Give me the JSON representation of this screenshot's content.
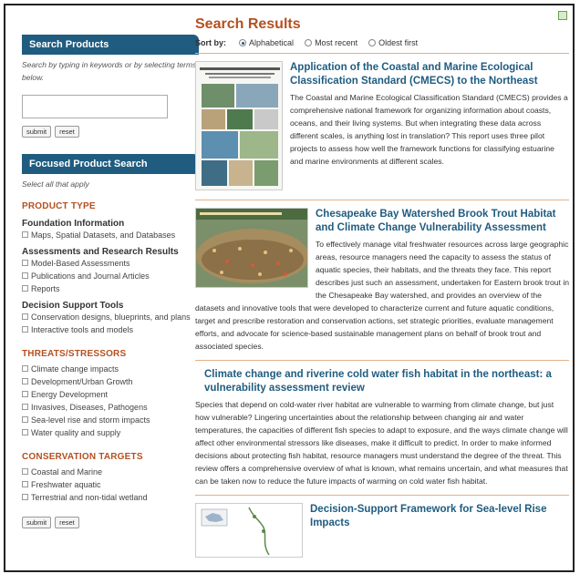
{
  "sidebar": {
    "search_heading": "Search Products",
    "search_help": "Search by typing in keywords or by selecting terms below.",
    "search_placeholder": "",
    "submit_label": "submit",
    "reset_label": "reset",
    "focused_heading": "Focused Product Search",
    "focused_help": "Select all that apply",
    "product_type_title": "PRODUCT TYPE",
    "foundation_title": "Foundation Information",
    "foundation_items": [
      "Maps, Spatial Datasets, and Databases"
    ],
    "assessments_title": "Assessments and Research Results",
    "assessments_items": [
      "Model-Based Assessments",
      "Publications and Journal Articles",
      "Reports"
    ],
    "decision_title": "Decision Support Tools",
    "decision_items": [
      "Conservation designs, blueprints, and plans",
      "Interactive tools and models"
    ],
    "threats_title": "THREATS/STRESSORS",
    "threats_items": [
      "Climate change impacts",
      "Development/Urban Growth",
      "Energy Development",
      "Invasives, Diseases, Pathogens",
      "Sea-level rise and storm impacts",
      "Water quality and supply"
    ],
    "targets_title": "CONSERVATION TARGETS",
    "targets_items": [
      "Coastal and Marine",
      "Freshwater aquatic",
      "Terrestrial and non-tidal wetland"
    ],
    "submit_label_2": "submit",
    "reset_label_2": "reset"
  },
  "main": {
    "title": "Search Results",
    "sort_label": "Sort by:",
    "sort_options": [
      "Alphabetical",
      "Most recent",
      "Oldest first"
    ],
    "sort_selected": "Alphabetical",
    "results": [
      {
        "title": "Application of the Coastal and Marine Ecological Classification Standard (CMECS) to the Northeast",
        "description": "The Coastal and Marine Ecological Classification Standard (CMECS) provides a comprehensive national framework for organizing information about coasts, oceans, and their living systems. But when integrating these data across different scales, is anything lost in translation? This report uses three pilot projects to assess how well the framework functions for classifying estuarine and marine environments at different scales."
      },
      {
        "title": "Chesapeake Bay Watershed Brook Trout Habitat and Climate Change Vulnerability Assessment",
        "description": "To effectively manage vital freshwater resources across large geographic areas, resource managers need the capacity to assess the status of aquatic species, their habitats, and the threats they face. This report describes just such an assessment, undertaken for Eastern brook trout in the Chesapeake Bay watershed, and provides an overview of the datasets and innovative tools that were developed to characterize current and future aquatic conditions, target and prescribe restoration and conservation actions, set strategic priorities, evaluate management efforts, and advocate for science-based sustainable management plans on behalf of brook trout and associated species."
      },
      {
        "title": "Climate change and riverine cold water fish habitat in the northeast: a vulnerability assessment review",
        "description": "Species that depend on cold-water river habitat are vulnerable to warming from climate change, but just how vulnerable? Lingering uncertainties about the relationship between changing air and water temperatures, the capacities of different fish species to adapt to exposure, and the ways climate change will affect other environmental stressors like diseases, make it difficult to predict. In order to make informed decisions about protecting fish habitat, resource managers must understand the degree of the threat. This review offers a comprehensive overview of what is known, what remains uncertain, and what measures that can be taken now to reduce the future impacts of warming on cold water fish habitat."
      },
      {
        "title": "Decision-Support Framework for Sea-level Rise Impacts",
        "description": ""
      }
    ]
  },
  "colors": {
    "accent": "#1f5c80",
    "section": "#b5501f",
    "divider": "#e2b088"
  }
}
